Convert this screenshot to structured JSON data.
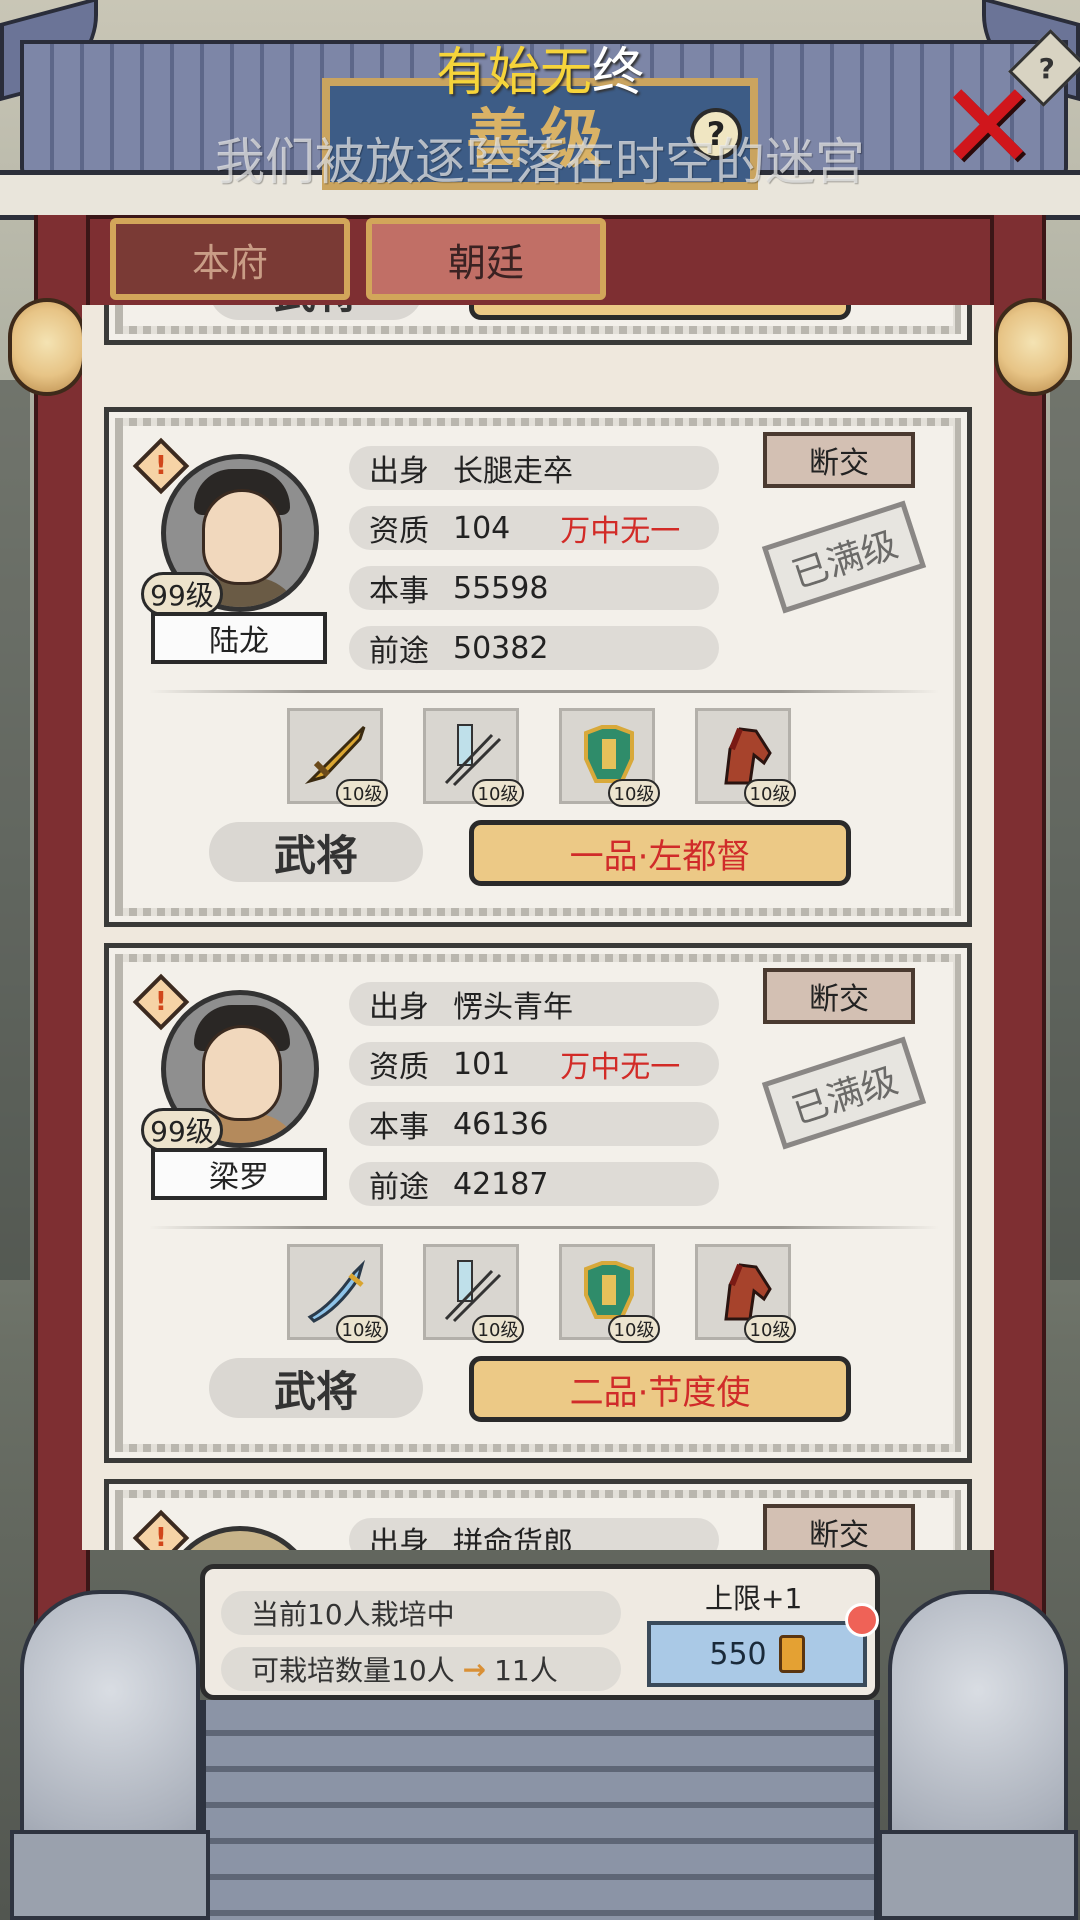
{
  "overlay": {
    "title_part1": "有始无",
    "title_part2": "终",
    "subtitle": "我们被放逐坠落在时空的迷宫"
  },
  "header": {
    "plaque_text": "善级",
    "help_symbol": "?",
    "close_symbol": "✕"
  },
  "tabs": [
    {
      "label": "本府",
      "active": false
    },
    {
      "label": "朝廷",
      "active": true
    }
  ],
  "cards": [
    {
      "level": "99级",
      "name": "陆龙",
      "origin_label": "出身",
      "origin": "长腿走卒",
      "aptitude_label": "资质",
      "aptitude": "104",
      "rarity": "万中无一",
      "skill_label": "本事",
      "skill": "55598",
      "prospect_label": "前途",
      "prospect": "50382",
      "break_label": "断交",
      "max_label": "已满级",
      "equipment": [
        {
          "icon": "sword-icon",
          "level": "10级"
        },
        {
          "icon": "arrows-icon",
          "level": "10级"
        },
        {
          "icon": "armor-icon",
          "level": "10级"
        },
        {
          "icon": "horse-icon",
          "level": "10级"
        }
      ],
      "role": "武将",
      "rank": "一品·左都督"
    },
    {
      "level": "99级",
      "name": "梁罗",
      "origin_label": "出身",
      "origin": "愣头青年",
      "aptitude_label": "资质",
      "aptitude": "101",
      "rarity": "万中无一",
      "skill_label": "本事",
      "skill": "46136",
      "prospect_label": "前途",
      "prospect": "42187",
      "break_label": "断交",
      "max_label": "已满级",
      "equipment": [
        {
          "icon": "sword-icon",
          "level": "10级"
        },
        {
          "icon": "arrows-icon",
          "level": "10级"
        },
        {
          "icon": "armor-icon",
          "level": "10级"
        },
        {
          "icon": "horse-icon",
          "level": "10级"
        }
      ],
      "role": "武将",
      "rank": "二品·节度使"
    },
    {
      "origin_label": "出身",
      "origin": "拼命货郎",
      "break_label": "断交"
    }
  ],
  "top_partial": {
    "role": "武将"
  },
  "footer": {
    "current_text": "当前10人栽培中",
    "capacity_text": "可栽培数量10人",
    "capacity_next": "11人",
    "limit_label": "上限+1",
    "cost": "550"
  },
  "colors": {
    "rarity_red": "#d22b27",
    "rank_bar": "#ecc986",
    "tab_active": "#c16f66",
    "tab_inactive": "#7a3a35",
    "pillar": "#7e2f32",
    "cost_button": "#aac9e6"
  }
}
